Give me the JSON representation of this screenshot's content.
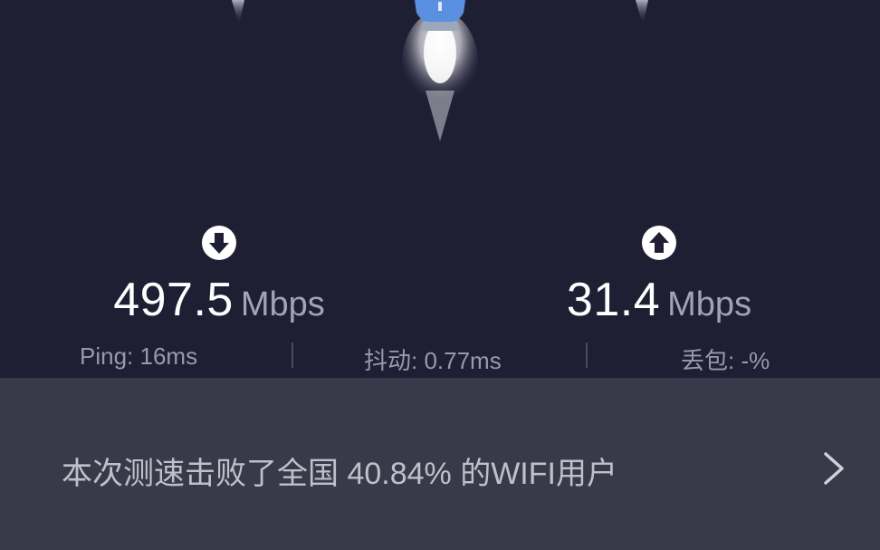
{
  "download": {
    "value": "497.5",
    "unit": "Mbps",
    "icon": "download-arrow-icon"
  },
  "upload": {
    "value": "31.4",
    "unit": "Mbps",
    "icon": "upload-arrow-icon"
  },
  "metrics": {
    "ping": "Ping: 16ms",
    "jitter": "抖动: 0.77ms",
    "loss": "丢包: -%"
  },
  "banner": {
    "text": "本次测速击败了全国 40.84% 的WIFI用户",
    "icon": "chevron-right-icon"
  },
  "colors": {
    "background": "#1f1f34",
    "banner": "#3a3949",
    "rocket_body": "#5b8fe0"
  }
}
